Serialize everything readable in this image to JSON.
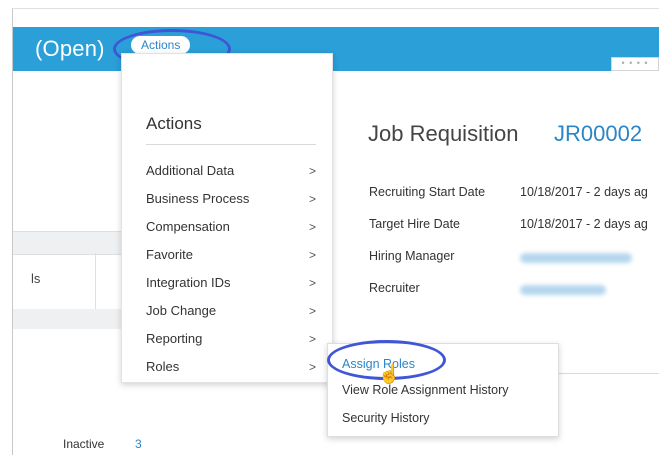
{
  "header": {
    "title": "(Open)",
    "actions_button": "Actions"
  },
  "left_panel": {
    "truncated_label": "ls",
    "inactive_label": "Inactive",
    "inactive_count": "3"
  },
  "menu": {
    "title": "Actions",
    "items": [
      {
        "label": "Additional Data",
        "icon": "chevron-right-icon"
      },
      {
        "label": "Business Process",
        "icon": "chevron-right-icon"
      },
      {
        "label": "Compensation",
        "icon": "chevron-right-icon"
      },
      {
        "label": "Favorite",
        "icon": "chevron-right-icon"
      },
      {
        "label": "Integration IDs",
        "icon": "chevron-right-icon"
      },
      {
        "label": "Job Change",
        "icon": "chevron-right-icon"
      },
      {
        "label": "Reporting",
        "icon": "chevron-right-icon"
      },
      {
        "label": "Roles",
        "icon": "chevron-right-icon"
      }
    ],
    "chevron": ">"
  },
  "submenu": {
    "items": [
      {
        "label": "Assign Roles",
        "highlighted": true
      },
      {
        "label": "View Role Assignment History",
        "highlighted": false
      },
      {
        "label": "Security History",
        "highlighted": false
      }
    ]
  },
  "requisition": {
    "title": "Job Requisition",
    "id": "JR00002",
    "fields": [
      {
        "label": "Recruiting Start Date",
        "value": "10/18/2017 - 2 days ag"
      },
      {
        "label": "Target Hire Date",
        "value": "10/18/2017 - 2 days ag"
      },
      {
        "label": "Hiring Manager",
        "value": ""
      },
      {
        "label": "Recruiter",
        "value": ""
      }
    ]
  },
  "colors": {
    "header_bg": "#2a9fd8",
    "link": "#2a86c8",
    "highlight_ring": "#3f56d6"
  }
}
